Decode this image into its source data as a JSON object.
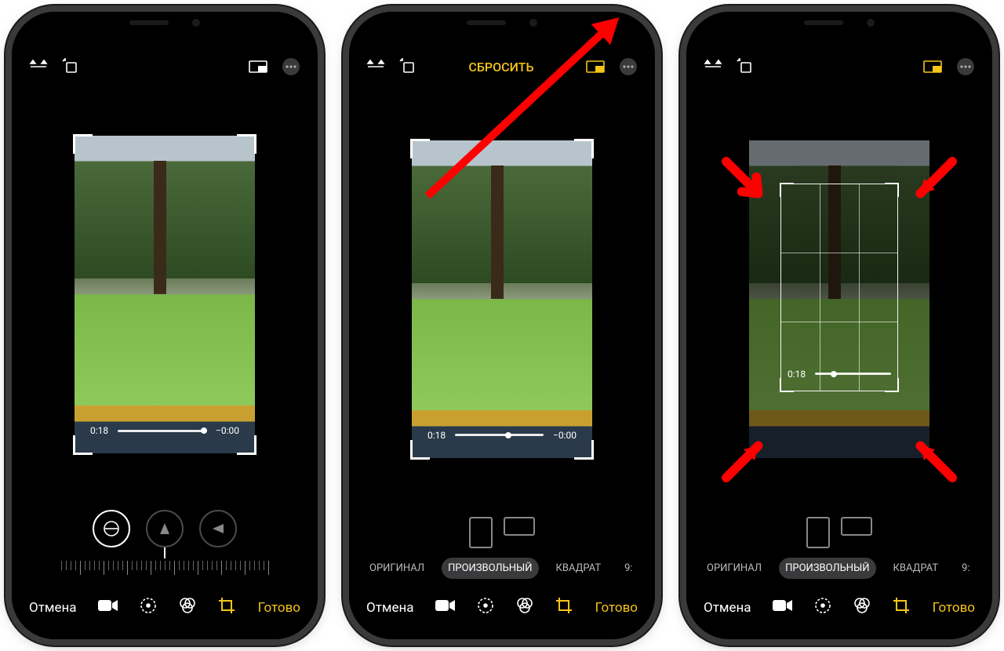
{
  "phones": [
    {
      "topbar": {
        "reset_label": ""
      },
      "video_time": {
        "current": "0:18",
        "remaining": "−0:00",
        "progress": 0.97
      },
      "bottom": {
        "cancel": "Отмена",
        "done": "Готово"
      }
    },
    {
      "topbar": {
        "reset_label": "СБРОСИТЬ"
      },
      "video_time": {
        "current": "0:18",
        "remaining": "−0:00",
        "progress": 0.6
      },
      "aspect": {
        "original": "ОРИГИНАЛ",
        "freeform": "ПРОИЗВОЛЬНЫЙ",
        "square": "КВАДРАТ",
        "more": "9:"
      },
      "bottom": {
        "cancel": "Отмена",
        "done": "Готово"
      }
    },
    {
      "topbar": {
        "reset_label": ""
      },
      "video_time": {
        "current": "0:18",
        "remaining": "",
        "progress": 0.25
      },
      "aspect": {
        "original": "ОРИГИНАЛ",
        "freeform": "ПРОИЗВОЛЬНЫЙ",
        "square": "КВАДРАТ",
        "more": "9:"
      },
      "bottom": {
        "cancel": "Отмена",
        "done": "Готово"
      }
    }
  ],
  "icons": {
    "flip": "flip-icon",
    "rotate": "rotate-icon",
    "aspect": "aspect-ratio-icon",
    "more": "more-icon",
    "straighten": "straighten-icon",
    "vertical": "vertical-perspective-icon",
    "horizontal": "horizontal-perspective-icon",
    "video": "video-icon",
    "adjust": "adjust-icon",
    "filters": "filters-icon",
    "crop": "crop-icon"
  },
  "colors": {
    "accent": "#f5c518",
    "annotation": "#ff0000"
  }
}
